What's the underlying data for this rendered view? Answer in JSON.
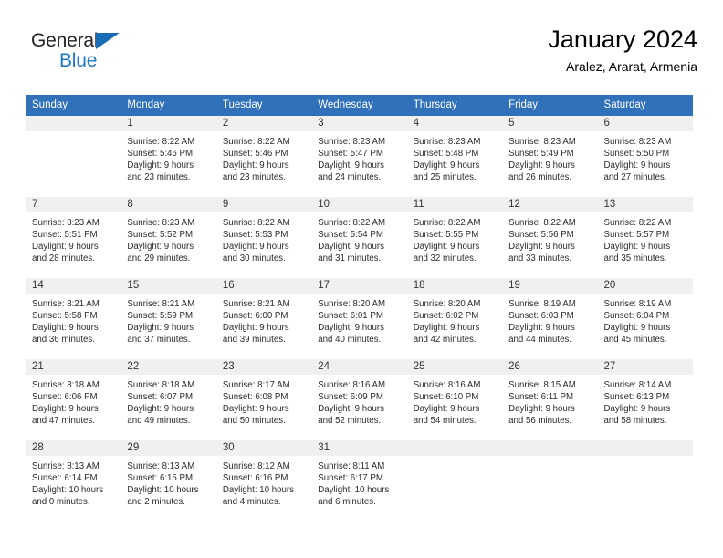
{
  "brand": {
    "line1": "General",
    "line2": "Blue",
    "triangle_icon": "brand-triangle-icon",
    "colors": {
      "dark": "#231f20",
      "blue": "#1f79c6"
    }
  },
  "header": {
    "title": "January 2024",
    "subtitle": "Aralez, Ararat, Armenia"
  },
  "colors": {
    "header_blue": "#3071b9",
    "week_separator": "#1f5fa6",
    "daynum_band": "#f0f0f0"
  },
  "calendar": {
    "weekday_headers": [
      "Sunday",
      "Monday",
      "Tuesday",
      "Wednesday",
      "Thursday",
      "Friday",
      "Saturday"
    ],
    "weeks": [
      [
        {
          "day": "",
          "lines": []
        },
        {
          "day": "1",
          "lines": [
            "Sunrise: 8:22 AM",
            "Sunset: 5:46 PM",
            "Daylight: 9 hours and 23 minutes."
          ]
        },
        {
          "day": "2",
          "lines": [
            "Sunrise: 8:22 AM",
            "Sunset: 5:46 PM",
            "Daylight: 9 hours and 23 minutes."
          ]
        },
        {
          "day": "3",
          "lines": [
            "Sunrise: 8:23 AM",
            "Sunset: 5:47 PM",
            "Daylight: 9 hours and 24 minutes."
          ]
        },
        {
          "day": "4",
          "lines": [
            "Sunrise: 8:23 AM",
            "Sunset: 5:48 PM",
            "Daylight: 9 hours and 25 minutes."
          ]
        },
        {
          "day": "5",
          "lines": [
            "Sunrise: 8:23 AM",
            "Sunset: 5:49 PM",
            "Daylight: 9 hours and 26 minutes."
          ]
        },
        {
          "day": "6",
          "lines": [
            "Sunrise: 8:23 AM",
            "Sunset: 5:50 PM",
            "Daylight: 9 hours and 27 minutes."
          ]
        }
      ],
      [
        {
          "day": "7",
          "lines": [
            "Sunrise: 8:23 AM",
            "Sunset: 5:51 PM",
            "Daylight: 9 hours and 28 minutes."
          ]
        },
        {
          "day": "8",
          "lines": [
            "Sunrise: 8:23 AM",
            "Sunset: 5:52 PM",
            "Daylight: 9 hours and 29 minutes."
          ]
        },
        {
          "day": "9",
          "lines": [
            "Sunrise: 8:22 AM",
            "Sunset: 5:53 PM",
            "Daylight: 9 hours and 30 minutes."
          ]
        },
        {
          "day": "10",
          "lines": [
            "Sunrise: 8:22 AM",
            "Sunset: 5:54 PM",
            "Daylight: 9 hours and 31 minutes."
          ]
        },
        {
          "day": "11",
          "lines": [
            "Sunrise: 8:22 AM",
            "Sunset: 5:55 PM",
            "Daylight: 9 hours and 32 minutes."
          ]
        },
        {
          "day": "12",
          "lines": [
            "Sunrise: 8:22 AM",
            "Sunset: 5:56 PM",
            "Daylight: 9 hours and 33 minutes."
          ]
        },
        {
          "day": "13",
          "lines": [
            "Sunrise: 8:22 AM",
            "Sunset: 5:57 PM",
            "Daylight: 9 hours and 35 minutes."
          ]
        }
      ],
      [
        {
          "day": "14",
          "lines": [
            "Sunrise: 8:21 AM",
            "Sunset: 5:58 PM",
            "Daylight: 9 hours and 36 minutes."
          ]
        },
        {
          "day": "15",
          "lines": [
            "Sunrise: 8:21 AM",
            "Sunset: 5:59 PM",
            "Daylight: 9 hours and 37 minutes."
          ]
        },
        {
          "day": "16",
          "lines": [
            "Sunrise: 8:21 AM",
            "Sunset: 6:00 PM",
            "Daylight: 9 hours and 39 minutes."
          ]
        },
        {
          "day": "17",
          "lines": [
            "Sunrise: 8:20 AM",
            "Sunset: 6:01 PM",
            "Daylight: 9 hours and 40 minutes."
          ]
        },
        {
          "day": "18",
          "lines": [
            "Sunrise: 8:20 AM",
            "Sunset: 6:02 PM",
            "Daylight: 9 hours and 42 minutes."
          ]
        },
        {
          "day": "19",
          "lines": [
            "Sunrise: 8:19 AM",
            "Sunset: 6:03 PM",
            "Daylight: 9 hours and 44 minutes."
          ]
        },
        {
          "day": "20",
          "lines": [
            "Sunrise: 8:19 AM",
            "Sunset: 6:04 PM",
            "Daylight: 9 hours and 45 minutes."
          ]
        }
      ],
      [
        {
          "day": "21",
          "lines": [
            "Sunrise: 8:18 AM",
            "Sunset: 6:06 PM",
            "Daylight: 9 hours and 47 minutes."
          ]
        },
        {
          "day": "22",
          "lines": [
            "Sunrise: 8:18 AM",
            "Sunset: 6:07 PM",
            "Daylight: 9 hours and 49 minutes."
          ]
        },
        {
          "day": "23",
          "lines": [
            "Sunrise: 8:17 AM",
            "Sunset: 6:08 PM",
            "Daylight: 9 hours and 50 minutes."
          ]
        },
        {
          "day": "24",
          "lines": [
            "Sunrise: 8:16 AM",
            "Sunset: 6:09 PM",
            "Daylight: 9 hours and 52 minutes."
          ]
        },
        {
          "day": "25",
          "lines": [
            "Sunrise: 8:16 AM",
            "Sunset: 6:10 PM",
            "Daylight: 9 hours and 54 minutes."
          ]
        },
        {
          "day": "26",
          "lines": [
            "Sunrise: 8:15 AM",
            "Sunset: 6:11 PM",
            "Daylight: 9 hours and 56 minutes."
          ]
        },
        {
          "day": "27",
          "lines": [
            "Sunrise: 8:14 AM",
            "Sunset: 6:13 PM",
            "Daylight: 9 hours and 58 minutes."
          ]
        }
      ],
      [
        {
          "day": "28",
          "lines": [
            "Sunrise: 8:13 AM",
            "Sunset: 6:14 PM",
            "Daylight: 10 hours and 0 minutes."
          ]
        },
        {
          "day": "29",
          "lines": [
            "Sunrise: 8:13 AM",
            "Sunset: 6:15 PM",
            "Daylight: 10 hours and 2 minutes."
          ]
        },
        {
          "day": "30",
          "lines": [
            "Sunrise: 8:12 AM",
            "Sunset: 6:16 PM",
            "Daylight: 10 hours and 4 minutes."
          ]
        },
        {
          "day": "31",
          "lines": [
            "Sunrise: 8:11 AM",
            "Sunset: 6:17 PM",
            "Daylight: 10 hours and 6 minutes."
          ]
        },
        {
          "day": "",
          "lines": []
        },
        {
          "day": "",
          "lines": []
        },
        {
          "day": "",
          "lines": []
        }
      ]
    ]
  }
}
